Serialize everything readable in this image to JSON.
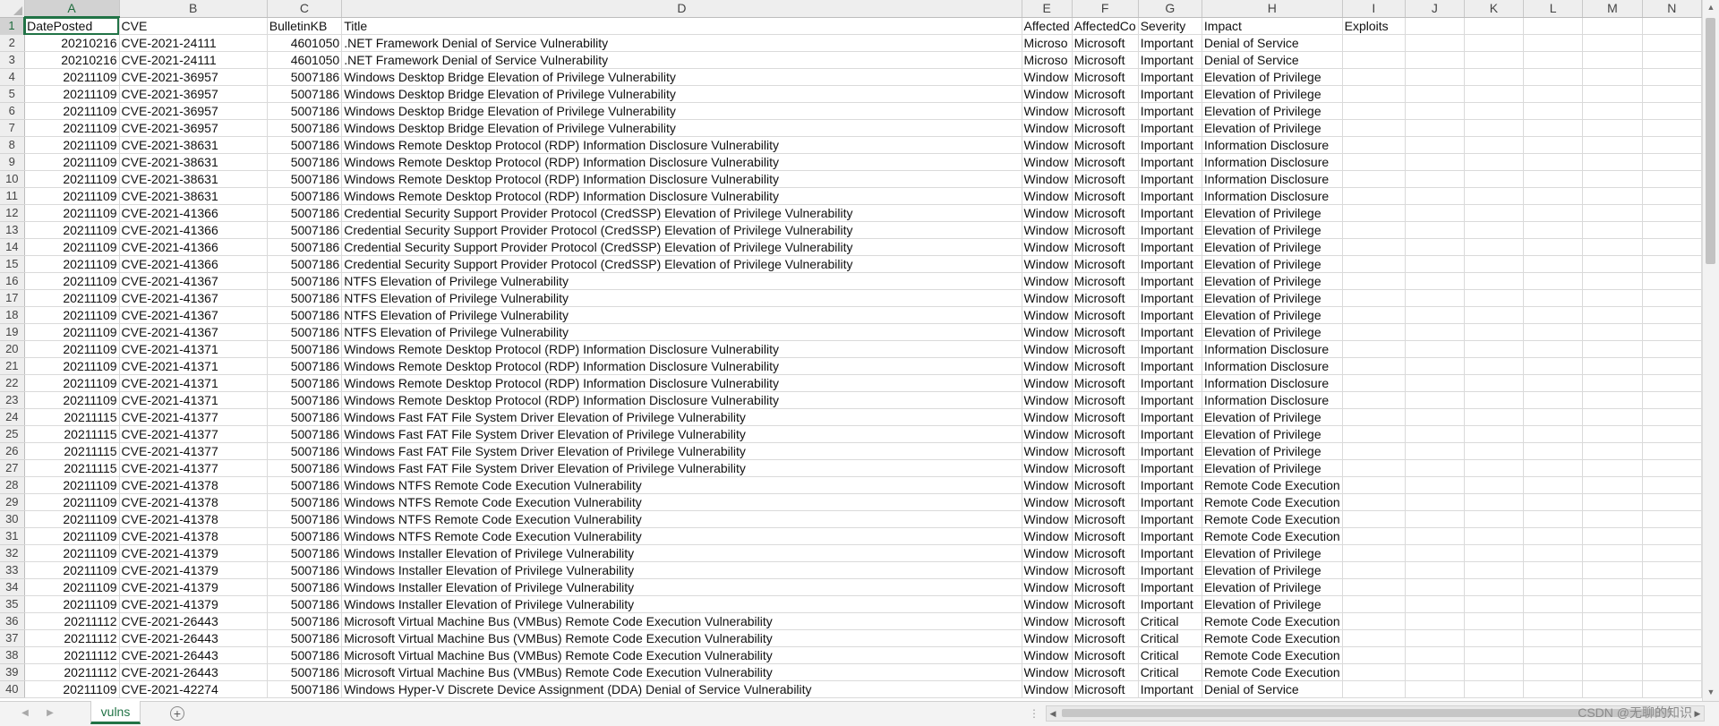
{
  "sheet": {
    "columns": [
      "A",
      "B",
      "C",
      "D",
      "E",
      "F",
      "G",
      "H",
      "I",
      "J",
      "K",
      "L",
      "M",
      "N"
    ],
    "active_column": "A",
    "active_row": 1,
    "header": [
      "DatePosted",
      "CVE",
      "BulletinKB",
      "Title",
      "Affected",
      "AffectedCo",
      "Severity",
      "Impact",
      "Exploits"
    ],
    "rows": [
      [
        "20210216",
        "CVE-2021-24111",
        "4601050",
        ".NET Framework Denial of Service Vulnerability",
        "Microso",
        "Microsoft",
        "Important",
        "Denial of Service",
        ""
      ],
      [
        "20210216",
        "CVE-2021-24111",
        "4601050",
        ".NET Framework Denial of Service Vulnerability",
        "Microso",
        "Microsoft",
        "Important",
        "Denial of Service",
        ""
      ],
      [
        "20211109",
        "CVE-2021-36957",
        "5007186",
        "Windows Desktop Bridge Elevation of Privilege Vulnerability",
        "Window",
        "Microsoft",
        "Important",
        "Elevation of Privilege",
        ""
      ],
      [
        "20211109",
        "CVE-2021-36957",
        "5007186",
        "Windows Desktop Bridge Elevation of Privilege Vulnerability",
        "Window",
        "Microsoft",
        "Important",
        "Elevation of Privilege",
        ""
      ],
      [
        "20211109",
        "CVE-2021-36957",
        "5007186",
        "Windows Desktop Bridge Elevation of Privilege Vulnerability",
        "Window",
        "Microsoft",
        "Important",
        "Elevation of Privilege",
        ""
      ],
      [
        "20211109",
        "CVE-2021-36957",
        "5007186",
        "Windows Desktop Bridge Elevation of Privilege Vulnerability",
        "Window",
        "Microsoft",
        "Important",
        "Elevation of Privilege",
        ""
      ],
      [
        "20211109",
        "CVE-2021-38631",
        "5007186",
        "Windows Remote Desktop Protocol (RDP) Information Disclosure Vulnerability",
        "Window",
        "Microsoft",
        "Important",
        "Information Disclosure",
        ""
      ],
      [
        "20211109",
        "CVE-2021-38631",
        "5007186",
        "Windows Remote Desktop Protocol (RDP) Information Disclosure Vulnerability",
        "Window",
        "Microsoft",
        "Important",
        "Information Disclosure",
        ""
      ],
      [
        "20211109",
        "CVE-2021-38631",
        "5007186",
        "Windows Remote Desktop Protocol (RDP) Information Disclosure Vulnerability",
        "Window",
        "Microsoft",
        "Important",
        "Information Disclosure",
        ""
      ],
      [
        "20211109",
        "CVE-2021-38631",
        "5007186",
        "Windows Remote Desktop Protocol (RDP) Information Disclosure Vulnerability",
        "Window",
        "Microsoft",
        "Important",
        "Information Disclosure",
        ""
      ],
      [
        "20211109",
        "CVE-2021-41366",
        "5007186",
        "Credential Security Support Provider Protocol (CredSSP) Elevation of Privilege Vulnerability",
        "Window",
        "Microsoft",
        "Important",
        "Elevation of Privilege",
        ""
      ],
      [
        "20211109",
        "CVE-2021-41366",
        "5007186",
        "Credential Security Support Provider Protocol (CredSSP) Elevation of Privilege Vulnerability",
        "Window",
        "Microsoft",
        "Important",
        "Elevation of Privilege",
        ""
      ],
      [
        "20211109",
        "CVE-2021-41366",
        "5007186",
        "Credential Security Support Provider Protocol (CredSSP) Elevation of Privilege Vulnerability",
        "Window",
        "Microsoft",
        "Important",
        "Elevation of Privilege",
        ""
      ],
      [
        "20211109",
        "CVE-2021-41366",
        "5007186",
        "Credential Security Support Provider Protocol (CredSSP) Elevation of Privilege Vulnerability",
        "Window",
        "Microsoft",
        "Important",
        "Elevation of Privilege",
        ""
      ],
      [
        "20211109",
        "CVE-2021-41367",
        "5007186",
        "NTFS Elevation of Privilege Vulnerability",
        "Window",
        "Microsoft",
        "Important",
        "Elevation of Privilege",
        ""
      ],
      [
        "20211109",
        "CVE-2021-41367",
        "5007186",
        "NTFS Elevation of Privilege Vulnerability",
        "Window",
        "Microsoft",
        "Important",
        "Elevation of Privilege",
        ""
      ],
      [
        "20211109",
        "CVE-2021-41367",
        "5007186",
        "NTFS Elevation of Privilege Vulnerability",
        "Window",
        "Microsoft",
        "Important",
        "Elevation of Privilege",
        ""
      ],
      [
        "20211109",
        "CVE-2021-41367",
        "5007186",
        "NTFS Elevation of Privilege Vulnerability",
        "Window",
        "Microsoft",
        "Important",
        "Elevation of Privilege",
        ""
      ],
      [
        "20211109",
        "CVE-2021-41371",
        "5007186",
        "Windows Remote Desktop Protocol (RDP) Information Disclosure Vulnerability",
        "Window",
        "Microsoft",
        "Important",
        "Information Disclosure",
        ""
      ],
      [
        "20211109",
        "CVE-2021-41371",
        "5007186",
        "Windows Remote Desktop Protocol (RDP) Information Disclosure Vulnerability",
        "Window",
        "Microsoft",
        "Important",
        "Information Disclosure",
        ""
      ],
      [
        "20211109",
        "CVE-2021-41371",
        "5007186",
        "Windows Remote Desktop Protocol (RDP) Information Disclosure Vulnerability",
        "Window",
        "Microsoft",
        "Important",
        "Information Disclosure",
        ""
      ],
      [
        "20211109",
        "CVE-2021-41371",
        "5007186",
        "Windows Remote Desktop Protocol (RDP) Information Disclosure Vulnerability",
        "Window",
        "Microsoft",
        "Important",
        "Information Disclosure",
        ""
      ],
      [
        "20211115",
        "CVE-2021-41377",
        "5007186",
        "Windows Fast FAT File System Driver Elevation of Privilege Vulnerability",
        "Window",
        "Microsoft",
        "Important",
        "Elevation of Privilege",
        ""
      ],
      [
        "20211115",
        "CVE-2021-41377",
        "5007186",
        "Windows Fast FAT File System Driver Elevation of Privilege Vulnerability",
        "Window",
        "Microsoft",
        "Important",
        "Elevation of Privilege",
        ""
      ],
      [
        "20211115",
        "CVE-2021-41377",
        "5007186",
        "Windows Fast FAT File System Driver Elevation of Privilege Vulnerability",
        "Window",
        "Microsoft",
        "Important",
        "Elevation of Privilege",
        ""
      ],
      [
        "20211115",
        "CVE-2021-41377",
        "5007186",
        "Windows Fast FAT File System Driver Elevation of Privilege Vulnerability",
        "Window",
        "Microsoft",
        "Important",
        "Elevation of Privilege",
        ""
      ],
      [
        "20211109",
        "CVE-2021-41378",
        "5007186",
        "Windows NTFS Remote Code Execution Vulnerability",
        "Window",
        "Microsoft",
        "Important",
        "Remote Code Execution",
        ""
      ],
      [
        "20211109",
        "CVE-2021-41378",
        "5007186",
        "Windows NTFS Remote Code Execution Vulnerability",
        "Window",
        "Microsoft",
        "Important",
        "Remote Code Execution",
        ""
      ],
      [
        "20211109",
        "CVE-2021-41378",
        "5007186",
        "Windows NTFS Remote Code Execution Vulnerability",
        "Window",
        "Microsoft",
        "Important",
        "Remote Code Execution",
        ""
      ],
      [
        "20211109",
        "CVE-2021-41378",
        "5007186",
        "Windows NTFS Remote Code Execution Vulnerability",
        "Window",
        "Microsoft",
        "Important",
        "Remote Code Execution",
        ""
      ],
      [
        "20211109",
        "CVE-2021-41379",
        "5007186",
        "Windows Installer Elevation of Privilege Vulnerability",
        "Window",
        "Microsoft",
        "Important",
        "Elevation of Privilege",
        ""
      ],
      [
        "20211109",
        "CVE-2021-41379",
        "5007186",
        "Windows Installer Elevation of Privilege Vulnerability",
        "Window",
        "Microsoft",
        "Important",
        "Elevation of Privilege",
        ""
      ],
      [
        "20211109",
        "CVE-2021-41379",
        "5007186",
        "Windows Installer Elevation of Privilege Vulnerability",
        "Window",
        "Microsoft",
        "Important",
        "Elevation of Privilege",
        ""
      ],
      [
        "20211109",
        "CVE-2021-41379",
        "5007186",
        "Windows Installer Elevation of Privilege Vulnerability",
        "Window",
        "Microsoft",
        "Important",
        "Elevation of Privilege",
        ""
      ],
      [
        "20211112",
        "CVE-2021-26443",
        "5007186",
        "Microsoft Virtual Machine Bus (VMBus) Remote Code Execution Vulnerability",
        "Window",
        "Microsoft",
        "Critical",
        "Remote Code Execution",
        ""
      ],
      [
        "20211112",
        "CVE-2021-26443",
        "5007186",
        "Microsoft Virtual Machine Bus (VMBus) Remote Code Execution Vulnerability",
        "Window",
        "Microsoft",
        "Critical",
        "Remote Code Execution",
        ""
      ],
      [
        "20211112",
        "CVE-2021-26443",
        "5007186",
        "Microsoft Virtual Machine Bus (VMBus) Remote Code Execution Vulnerability",
        "Window",
        "Microsoft",
        "Critical",
        "Remote Code Execution",
        ""
      ],
      [
        "20211112",
        "CVE-2021-26443",
        "5007186",
        "Microsoft Virtual Machine Bus (VMBus) Remote Code Execution Vulnerability",
        "Window",
        "Microsoft",
        "Critical",
        "Remote Code Execution",
        ""
      ],
      [
        "20211109",
        "CVE-2021-42274",
        "5007186",
        "Windows Hyper-V Discrete Device Assignment (DDA) Denial of Service Vulnerability",
        "Window",
        "Microsoft",
        "Important",
        "Denial of Service",
        ""
      ]
    ]
  },
  "tabs": {
    "active_label": "vulns",
    "add_label": "+"
  },
  "watermark": "CSDN @无聊的知识",
  "icons": {
    "scroll_up": "triangle-up-icon",
    "scroll_down": "triangle-down-icon",
    "scroll_left": "triangle-left-icon",
    "scroll_right": "triangle-right-icon"
  },
  "colors": {
    "accent": "#217346",
    "header_bg": "#eeeeee",
    "gridline": "#dadada"
  }
}
